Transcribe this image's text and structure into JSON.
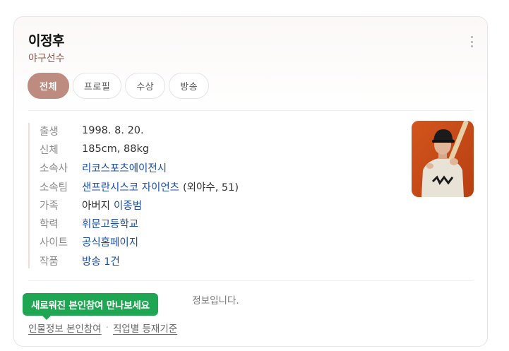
{
  "profile": {
    "name": "이정후",
    "occupation": "야구선수"
  },
  "tabs": [
    {
      "label": "전체",
      "active": true
    },
    {
      "label": "프로필",
      "active": false
    },
    {
      "label": "수상",
      "active": false
    },
    {
      "label": "방송",
      "active": false
    }
  ],
  "info": {
    "birth": {
      "label": "출생",
      "value": "1998. 8. 20."
    },
    "body": {
      "label": "신체",
      "value": "185cm, 88kg"
    },
    "agency": {
      "label": "소속사",
      "value": "리코스포츠에이전시"
    },
    "team": {
      "label": "소속팀",
      "value": "샌프란시스코 자이언츠",
      "detail": "(외야수, 51)"
    },
    "family": {
      "label": "가족",
      "relation": "아버지",
      "value": "이종범"
    },
    "education": {
      "label": "학력",
      "value": "휘문고등학교"
    },
    "site": {
      "label": "사이트",
      "value": "공식홈페이지"
    },
    "works": {
      "label": "작품",
      "value": "방송 1건"
    }
  },
  "notice": {
    "tail": "정보입니다."
  },
  "tooltip": {
    "text": "새로워진 본인참여 만나보세요"
  },
  "footer": {
    "link1": "인물정보 본인참여",
    "separator": "·",
    "link2": "직업별 등재기준"
  },
  "colors": {
    "accent": "#bd8b7f",
    "link": "#1d4ea6",
    "tooltip": "#1fa653",
    "subtitle": "#8b5a4c"
  }
}
